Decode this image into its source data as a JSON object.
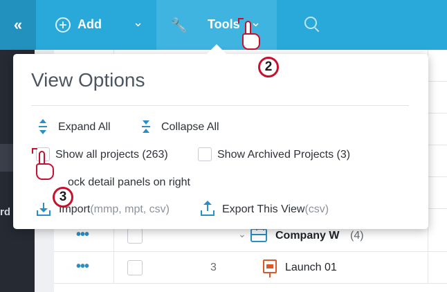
{
  "toolbar": {
    "collapse_glyph": "«",
    "add_label": "Add",
    "tools_label": "Tools",
    "chevron_glyph": "⌄",
    "wrench_glyph": "🔧",
    "colors": {
      "bar": "#29a9d9",
      "active": "#3fb4e0",
      "collapse_bg": "#2391bd"
    }
  },
  "sidebar": {
    "fragment": "rd"
  },
  "table": {
    "rows": [
      {
        "dots": "•••",
        "num": "",
        "expander": "⌄",
        "name": "Company W",
        "count": "(4)"
      },
      {
        "dots": "•••",
        "num": "3",
        "name": "Launch 01"
      }
    ]
  },
  "popup": {
    "title": "View Options",
    "expand_all": "Expand All",
    "collapse_all": "Collapse All",
    "show_all_projects": "Show all projects (263)",
    "show_archived": "Show Archived Projects (3)",
    "lock_detail_panels": "ock detail panels on right",
    "import_label": "Import",
    "import_hint": "(mmp, mpt, csv)",
    "export_label": "Export This View",
    "export_hint": "(csv)"
  },
  "callouts": [
    {
      "number": "2"
    },
    {
      "number": "3"
    }
  ],
  "colors": {
    "accent": "#2a8fc4",
    "callout": "#c8102e"
  }
}
